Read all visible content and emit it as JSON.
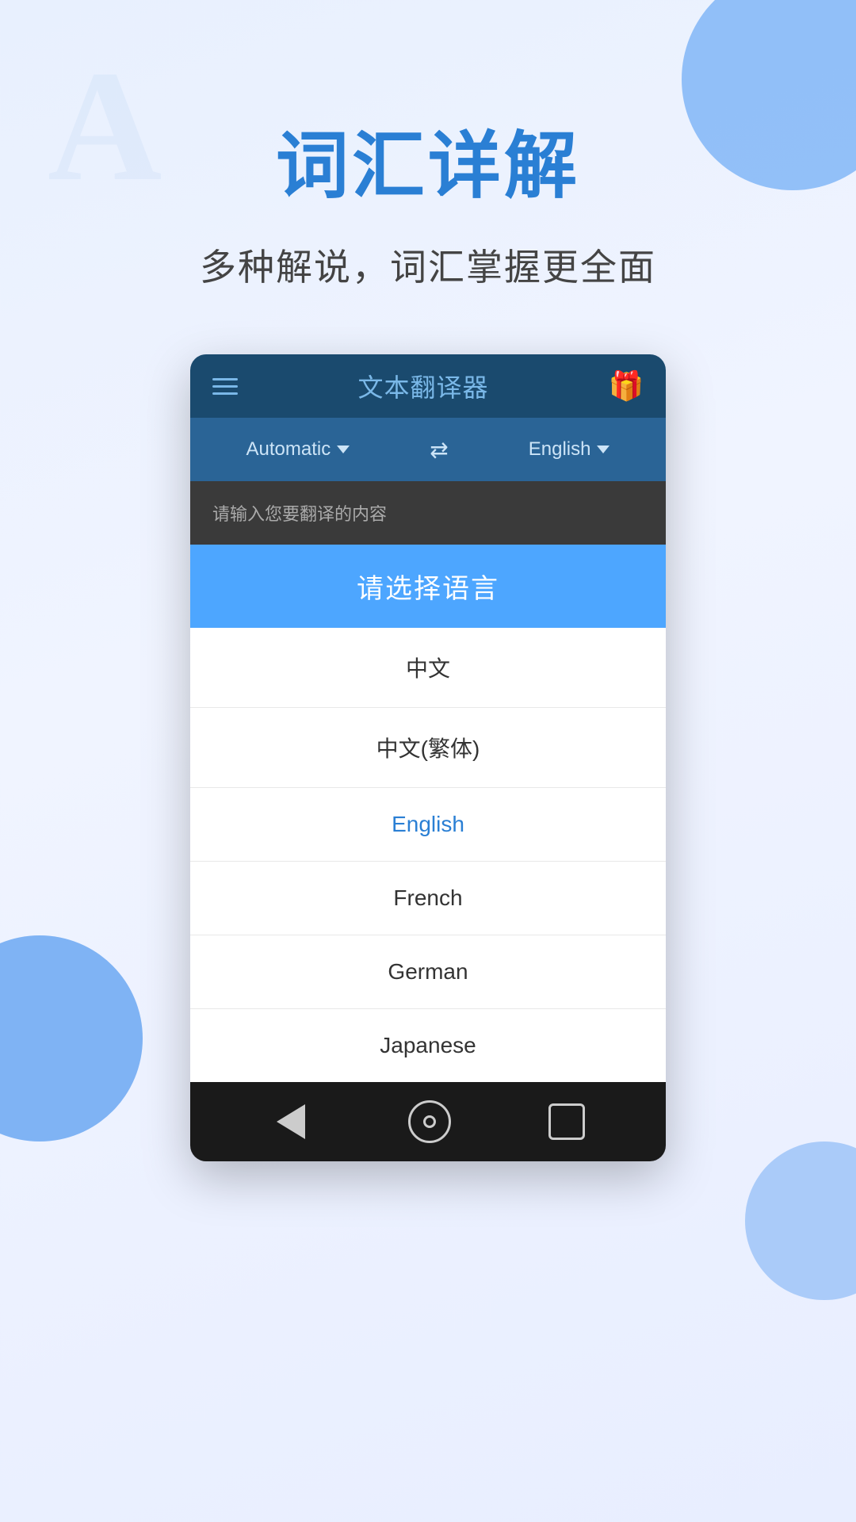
{
  "background": {
    "watermark_text": "A"
  },
  "title_section": {
    "main_title": "词汇详解",
    "subtitle": "多种解说，词汇掌握更全面"
  },
  "app": {
    "navbar": {
      "title": "文本翻译器",
      "menu_icon_label": "menu-icon",
      "gift_icon": "🎁"
    },
    "lang_bar": {
      "source_lang": "Automatic",
      "target_lang": "English",
      "swap_symbol": "⇄"
    },
    "input_area": {
      "placeholder": "请输入您要翻译的内容"
    },
    "dialog": {
      "title": "请选择语言",
      "items": [
        {
          "label": "中文",
          "selected": false
        },
        {
          "label": "中文(繁体)",
          "selected": false
        },
        {
          "label": "English",
          "selected": true
        },
        {
          "label": "French",
          "selected": false
        },
        {
          "label": "German",
          "selected": false
        },
        {
          "label": "Japanese",
          "selected": false
        }
      ]
    },
    "nav_bar": {
      "back_label": "back",
      "home_label": "home",
      "recents_label": "recents"
    }
  }
}
